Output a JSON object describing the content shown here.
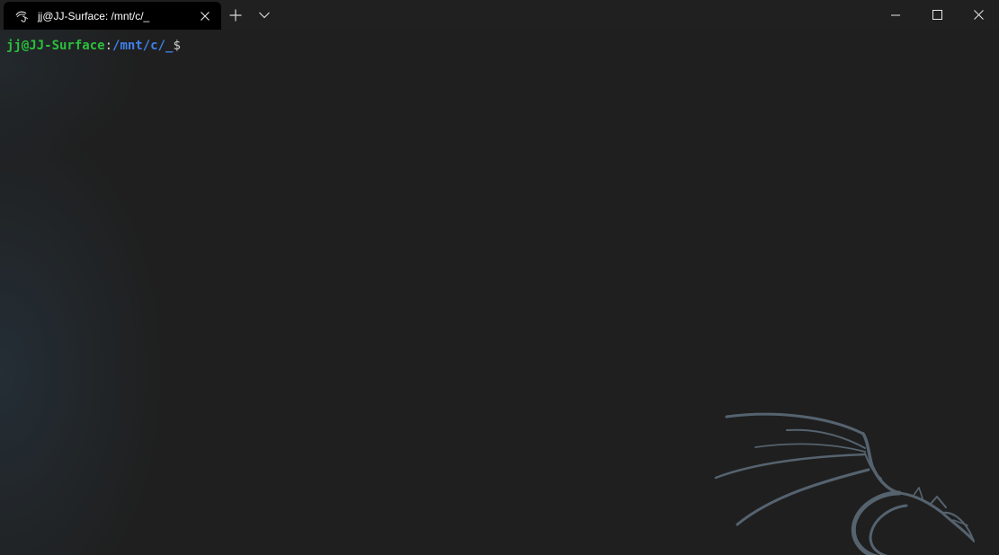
{
  "window": {
    "tab": {
      "title": "jj@JJ-Surface: /mnt/c/_",
      "icon": "kali-dragon-icon"
    },
    "toolbar": {
      "new_tab_icon": "plus-icon",
      "dropdown_icon": "chevron-down-icon"
    },
    "caption": {
      "minimize_icon": "minimize-icon",
      "maximize_icon": "maximize-icon",
      "close_icon": "close-icon"
    }
  },
  "terminal": {
    "prompt": {
      "user_host": "jj@JJ-Surface",
      "separator": ":",
      "path": "/mnt/c/_",
      "symbol": "$"
    },
    "background_logo": "kali-dragon-logo"
  },
  "colors": {
    "prompt_user": "#2bbf3c",
    "prompt_path": "#3f7fe8",
    "background": "#1f1f1f",
    "tab_active": "#000000",
    "titlebar": "#202020"
  }
}
